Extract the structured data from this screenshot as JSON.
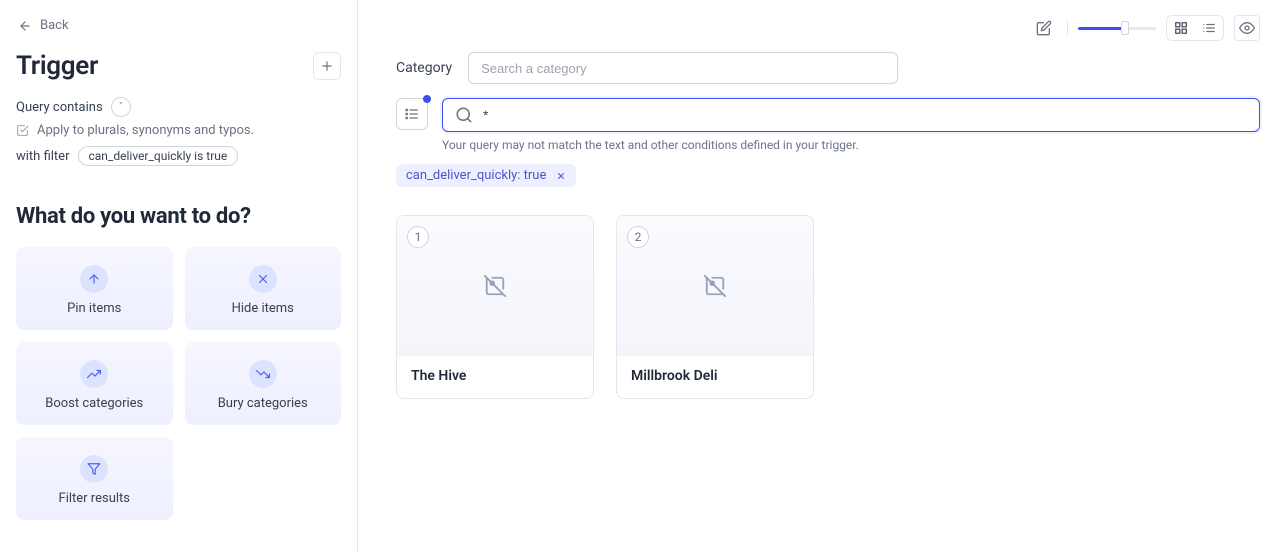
{
  "back_label": "Back",
  "sidebar": {
    "title": "Trigger",
    "query_label": "Query contains",
    "query_quote": "\"",
    "apply_text": "Apply to plurals, synonyms and typos.",
    "with_filter_label": "with filter",
    "filter_chip": "can_deliver_quickly is true",
    "section_title": "What do you want to do?",
    "actions": {
      "pin": "Pin items",
      "hide": "Hide items",
      "boost": "Boost categories",
      "bury": "Bury categories",
      "filter": "Filter results"
    }
  },
  "main": {
    "category_label": "Category",
    "category_placeholder": "Search a category",
    "search_value": "*",
    "hint": "Your query may not match the text and other conditions defined in your trigger.",
    "active_filter": "can_deliver_quickly: true",
    "results": [
      {
        "rank": "1",
        "title": "The Hive"
      },
      {
        "rank": "2",
        "title": "Millbrook Deli"
      }
    ]
  }
}
